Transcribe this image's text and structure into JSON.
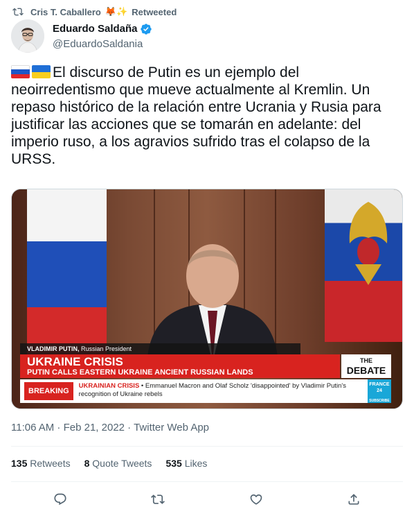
{
  "retweet": {
    "user": "Cris T. Caballero",
    "emoji": "🦊✨",
    "label": "Retweeted"
  },
  "author": {
    "name": "Eduardo Saldaña",
    "handle": "@EduardoSaldania",
    "verified": true
  },
  "tweet": {
    "flags": [
      "russia-flag",
      "ukraine-flag"
    ],
    "text": "El discurso de Putin es un ejemplo del neoirredentismo que mueve actualmente al Kremlin. Un repaso histórico de la relación entre Ucrania y Rusia para justificar las acciones que se tomarán en adelante: del imperio ruso, a los agravios sufrido tras el colapso de la URSS."
  },
  "media": {
    "name_bar_name": "VLADIMIR PUTIN,",
    "name_bar_role": "Russian President",
    "headline": "UKRAINE CRISIS",
    "subheadline": "PUTIN CALLS EASTERN UKRAINE ANCIENT RUSSIAN LANDS",
    "debate_the": "THE",
    "debate_word": "DEBATE",
    "breaking_tag": "BREAKING",
    "breaking_label": "UKRAINIAN CRISIS",
    "breaking_text": " • Emmanuel Macron and Olaf Scholz 'disappointed' by Vladimir Putin's recognition of Ukraine rebels",
    "channel_logo": "FRANCE 24",
    "channel_sub": "SUBSCRIBE"
  },
  "meta": {
    "time": "11:06 AM",
    "sep": " · ",
    "date": "Feb 21, 2022",
    "source": "Twitter Web App"
  },
  "stats": {
    "retweets_count": "135",
    "retweets_label": "Retweets",
    "quotes_count": "8",
    "quotes_label": "Quote Tweets",
    "likes_count": "535",
    "likes_label": "Likes"
  },
  "colors": {
    "text": "#0f1419",
    "secondary": "#536471",
    "verified": "#1d9bf0",
    "divider": "#eff3f4",
    "news_red": "#d8231f"
  },
  "icons": {
    "retweet_indicator": "retweet-icon",
    "verified": "verified-badge-icon",
    "reply": "reply-icon",
    "retweet": "retweet-icon",
    "like": "heart-icon",
    "share": "share-icon"
  }
}
